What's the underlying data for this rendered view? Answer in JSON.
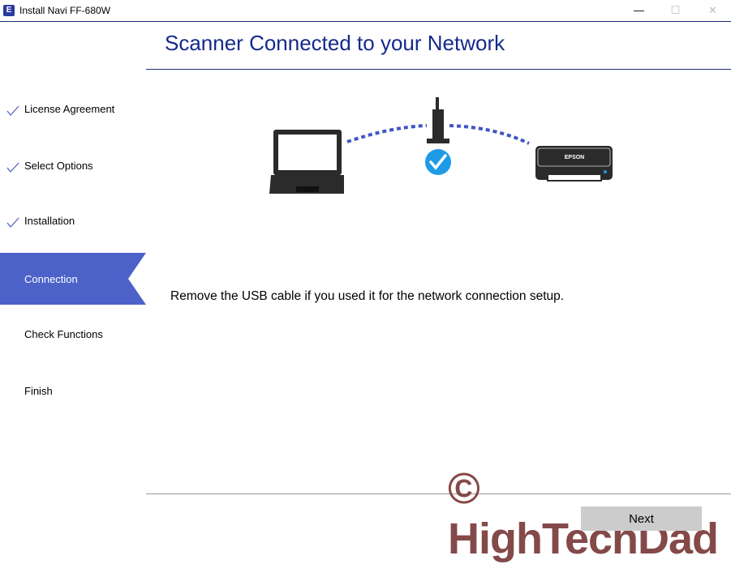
{
  "window": {
    "title": "Install Navi FF-680W",
    "app_icon": "E",
    "controls": {
      "minimize": "—",
      "maximize": "☐",
      "close": "✕"
    }
  },
  "sidebar": {
    "steps": [
      {
        "label": "License Agreement",
        "status": "completed"
      },
      {
        "label": "Select Options",
        "status": "completed"
      },
      {
        "label": "Installation",
        "status": "completed"
      },
      {
        "label": "Connection",
        "status": "active"
      },
      {
        "label": "Check Functions",
        "status": "pending"
      },
      {
        "label": "Finish",
        "status": "pending"
      }
    ]
  },
  "main": {
    "heading": "Scanner Connected to your Network",
    "illustration": {
      "scanner_brand": "EPSON"
    },
    "message": "Remove the USB cable if you used it for the network connection setup."
  },
  "footer": {
    "next_label": "Next"
  },
  "watermark": "© HighTechDad",
  "colors": {
    "accent": "#4c62c9",
    "heading": "#152a8a",
    "check": "#1e9be6",
    "dots": "#3f56c2"
  }
}
